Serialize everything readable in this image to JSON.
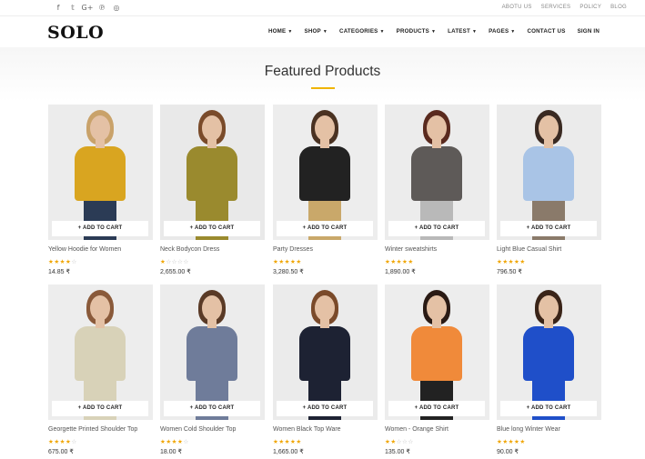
{
  "social": [
    {
      "icon": "facebook-icon",
      "glyph": "f"
    },
    {
      "icon": "twitter-icon",
      "glyph": "𝕥"
    },
    {
      "icon": "google-plus-icon",
      "glyph": "G+"
    },
    {
      "icon": "pinterest-icon",
      "glyph": "℗"
    },
    {
      "icon": "instagram-icon",
      "glyph": "◎"
    }
  ],
  "toplinks": [
    "ABOTU US",
    "SERVICES",
    "POLICY",
    "BLOG"
  ],
  "logo": "SOLO",
  "nav": [
    {
      "label": "HOME",
      "caret": "▼"
    },
    {
      "label": "SHOP",
      "caret": "▼"
    },
    {
      "label": "CATEGORIES",
      "caret": "▼"
    },
    {
      "label": "PRODUCTS",
      "caret": "▼"
    },
    {
      "label": "LATEST",
      "caret": "▼"
    },
    {
      "label": "PAGES",
      "caret": "▼"
    },
    {
      "label": "CONTACT US",
      "caret": ""
    },
    {
      "label": "SIGN IN",
      "caret": ""
    }
  ],
  "section_title": "Featured Products",
  "cart_label": "+ ADD TO CART",
  "accent": "#f0b400",
  "products": [
    {
      "name": "Yellow Hoodie for Women",
      "price": "14.85 ₹",
      "rating": 4,
      "top": "#d9a520",
      "bottom": "#2b3b55",
      "hair": "#c9a26a",
      "bg": "#ececec"
    },
    {
      "name": "Neck Bodycon Dress",
      "price": "2,655.00 ₹",
      "rating": 1,
      "top": "#9a8a2e",
      "bottom": "#9a8a2e",
      "hair": "#7a4b2a",
      "bg": "#e9e9e9"
    },
    {
      "name": "Party Dresses",
      "price": "3,280.50 ₹",
      "rating": 5,
      "top": "#222222",
      "bottom": "#c9a86a",
      "hair": "#4a3222",
      "bg": "#ededed"
    },
    {
      "name": "Winter sweatshirts",
      "price": "1,890.00 ₹",
      "rating": 5,
      "top": "#5e5a58",
      "bottom": "#b9b9b9",
      "hair": "#5a2a1e",
      "bg": "#ececec"
    },
    {
      "name": "Light Blue Casual Shirt",
      "price": "796.50 ₹",
      "rating": 5,
      "top": "#a9c4e6",
      "bottom": "#8a7a6a",
      "hair": "#3a2a22",
      "bg": "#ebebeb"
    },
    {
      "name": "Georgette Printed Shoulder Top",
      "price": "675.00 ₹",
      "rating": 4,
      "top": "#d8d2b8",
      "bottom": "#d8d2b8",
      "hair": "#8a5a3a",
      "bg": "#ededed"
    },
    {
      "name": "Women Cold Shoulder Top",
      "price": "18.00 ₹",
      "rating": 4,
      "top": "#6f7c9a",
      "bottom": "#6f7c9a",
      "hair": "#5a3a26",
      "bg": "#ececec"
    },
    {
      "name": "Women Black Top Ware",
      "price": "1,665.00 ₹",
      "rating": 5,
      "top": "#1d2233",
      "bottom": "#1d2233",
      "hair": "#7a4a2a",
      "bg": "#ebebeb"
    },
    {
      "name": "Women - Orange Shirt",
      "price": "135.00 ₹",
      "rating": 2,
      "top": "#f08a3a",
      "bottom": "#222222",
      "hair": "#2a1a14",
      "bg": "#ededed"
    },
    {
      "name": "Blue long Winter Wear",
      "price": "90.00 ₹",
      "rating": 5,
      "top": "#1f4fc9",
      "bottom": "#1f4fc9",
      "hair": "#3a2418",
      "bg": "#ececec"
    }
  ]
}
